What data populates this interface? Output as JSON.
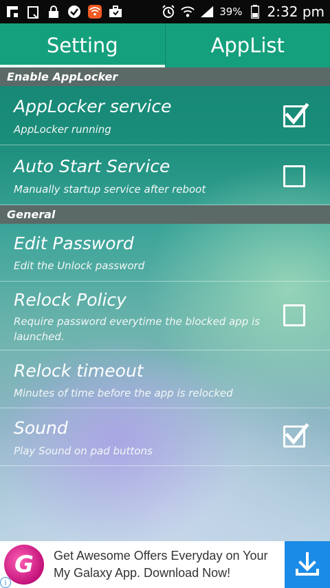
{
  "status_bar": {
    "icons": [
      "flipboard-icon",
      "clipboard-icon",
      "lock-icon",
      "check-icon",
      "wifi-hotspot-icon",
      "briefcase-icon",
      "alarm-icon",
      "wifi-icon",
      "signal-icon"
    ],
    "battery": "39%",
    "time": "2:32 pm"
  },
  "tabs": [
    {
      "label": "Setting",
      "active": true
    },
    {
      "label": "AppList",
      "active": false
    }
  ],
  "sections": [
    {
      "header": "Enable AppLocker",
      "items": [
        {
          "title": "AppLocker service",
          "summary": "AppLocker running",
          "checkbox": true,
          "checked": true
        },
        {
          "title": "Auto Start Service",
          "summary": "Manually startup service after reboot",
          "checkbox": true,
          "checked": false
        }
      ]
    },
    {
      "header": "General",
      "items": [
        {
          "title": "Edit Password",
          "summary": "Edit the Unlock password",
          "checkbox": false
        },
        {
          "title": "Relock Policy",
          "summary_line1": "Require password everytime the blocked app is",
          "summary_line2": "launched.",
          "checkbox": true,
          "checked": false
        },
        {
          "title": "Relock timeout",
          "summary": "Minutes of time before the app is relocked",
          "checkbox": false
        },
        {
          "title": "Sound",
          "summary": "Play Sound on pad buttons",
          "checkbox": true,
          "checked": true
        }
      ]
    }
  ],
  "ad": {
    "logo_letter": "G",
    "line1": "Get Awesome Offers Everyday on Your",
    "line2": "My Galaxy App. Download Now!",
    "info_symbol": "i",
    "colors": {
      "download_bg": "#1a8be6",
      "logo": "#d6188c"
    }
  },
  "colors": {
    "tab_bar": "#15a07d",
    "section_header": "#5b6a67",
    "status_bar": "#0a0a0a"
  }
}
